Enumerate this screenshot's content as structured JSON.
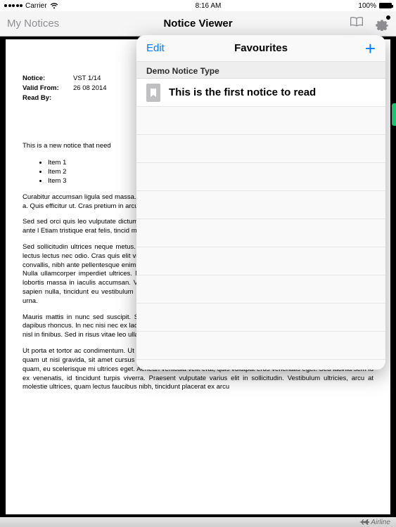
{
  "status": {
    "carrier": "Carrier",
    "wifi": true,
    "time": "8:16 AM",
    "battery_pct": "100%"
  },
  "nav": {
    "back_label": "My Notices",
    "title": "Notice Viewer"
  },
  "document": {
    "meta": {
      "notice_label": "Notice:",
      "notice_value": "VST 1/14",
      "valid_label": "Valid From:",
      "valid_value": "26 08 2014",
      "readby_label": "Read By:",
      "readby_value": ""
    },
    "intro": "This is a new notice that need",
    "items": [
      "Item 1",
      "Item 2",
      "Item 3"
    ],
    "paragraphs": [
      "Curabitur accumsan ligula sed massa. In consequat augue sed sapien tortor, euismod et sapien commodo erat feugiat a. Quis efficitur ut. Cras pretium in arcu magna. Vestibulum porta dui",
      "Sed sed orci quis leo vulputate dictumst. Quisque nec molestie Maecenas ut urna dui. Etiam Suspendisse venenatis ante l Etiam tristique erat felis, tincid malesuada tortor. sed vulputa",
      "Sed sollicitudin ultrices neque metus. Phasellus lacinia, sem at ultricies sodales, urna nisi finibus turpis, vel sagittis lectus lectus nec odio. Cras quis elit vitae velit ullamcorper convallis ut pharetra lorem. Nulla mollis, mi non bibendum convallis, nibh ante pellentesque enim, in semper magna elit eu sapien. Phasellus et tristique arcu, vitae tincidunt orci. Nulla ullamcorper imperdiet ultrices. Nulla condimentum sed lorem at laoreet. Pellentesque vel laoreet erat. Morbi lobortis massa in iaculis accumsan. Vivamus velit lacus, vestibulum vitae euismod ac, malesuada at sem. Quisque sapien nulla, tincidunt eu vestibulum in, congue tempus ligula. Ut ante justo, eleifend et enim eu, ornare venenatis urna.",
      "Mauris mattis in nunc sed suscipit. Sed faucibus dapibus tortor sed rhoncus. Pellentesque pellentesque est eget dapibus rhoncus. In nec nisi nec ex lacinia fringilla sed ut augue. Quisque eu eros est. Vestibulum interdum fermentum nisl in finibus. Sed in risus vitae leo ullamcorper sodales.",
      "Ut porta et tortor ac condimentum. Ut vel aliquet massa, at tempor erat. Nulla varius ac nibh ac viverra. Mauris varius quam ut nisi gravida, sit amet cursus enim luctus. Nulla vestibulum mattis turpis eu tincidunt. Quisque pharetra sem quam, eu scelerisque mi ultrices eget. Aenean vehicula velit erat, quis volutpat eros venenatis eget. Sed lacinia sem id ex venenatis, id tincidunt turpis viverra. Praesent vulputate varius elit in sollicitudin. Vestibulum ultricies, arcu at molestie ultrices, quam lectus faucibus nibh, tincidunt placerat ex arcu"
    ]
  },
  "popover": {
    "edit_label": "Edit",
    "title": "Favourites",
    "section_header": "Demo Notice Type",
    "first_item": "This is the first notice to read"
  },
  "footer": {
    "brand": "Airline"
  }
}
